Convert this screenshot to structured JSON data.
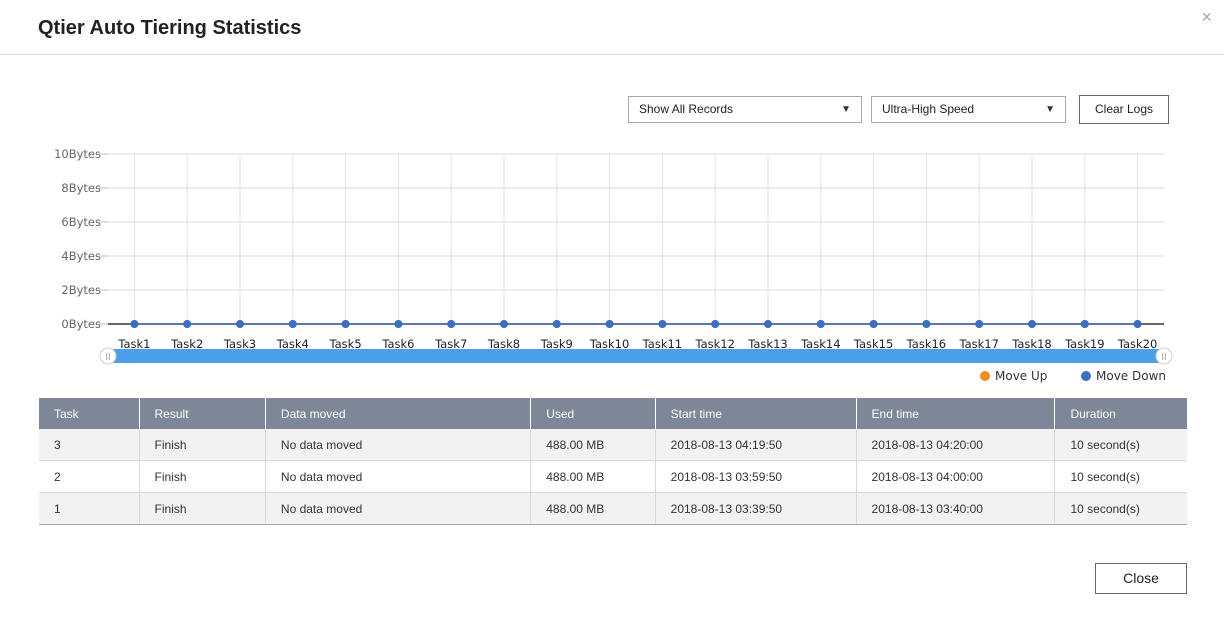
{
  "dialog": {
    "title": "Qtier Auto Tiering Statistics",
    "close_glyph": "×"
  },
  "filters": {
    "records_value": "Show All Records",
    "speed_value": "Ultra-High Speed",
    "caret": "▼",
    "clear_logs_label": "Clear Logs"
  },
  "chart_data": {
    "type": "line",
    "categories": [
      "Task1",
      "Task2",
      "Task3",
      "Task4",
      "Task5",
      "Task6",
      "Task7",
      "Task8",
      "Task9",
      "Task10",
      "Task11",
      "Task12",
      "Task13",
      "Task14",
      "Task15",
      "Task16",
      "Task17",
      "Task18",
      "Task19",
      "Task20"
    ],
    "yticks": [
      "0Bytes",
      "2Bytes",
      "4Bytes",
      "6Bytes",
      "8Bytes",
      "10Bytes"
    ],
    "ylim": [
      0,
      10
    ],
    "grid": true,
    "legend_position": "bottom-right",
    "series": [
      {
        "name": "Move Up",
        "color": "#f28d1f",
        "values": [
          0,
          0,
          0,
          0,
          0,
          0,
          0,
          0,
          0,
          0,
          0,
          0,
          0,
          0,
          0,
          0,
          0,
          0,
          0,
          0
        ]
      },
      {
        "name": "Move Down",
        "color": "#3a6fc4",
        "values": [
          0,
          0,
          0,
          0,
          0,
          0,
          0,
          0,
          0,
          0,
          0,
          0,
          0,
          0,
          0,
          0,
          0,
          0,
          0,
          0
        ]
      }
    ],
    "navigator": {
      "color": "#4a9eea",
      "handle_glyph": "ll"
    }
  },
  "table": {
    "columns": [
      "Task",
      "Result",
      "Data moved",
      "Used",
      "Start time",
      "End time",
      "Duration"
    ],
    "rows": [
      [
        "3",
        "Finish",
        "No data moved",
        "488.00 MB",
        "2018-08-13 04:19:50",
        "2018-08-13 04:20:00",
        "10 second(s)"
      ],
      [
        "2",
        "Finish",
        "No data moved",
        "488.00 MB",
        "2018-08-13 03:59:50",
        "2018-08-13 04:00:00",
        "10 second(s)"
      ],
      [
        "1",
        "Finish",
        "No data moved",
        "488.00 MB",
        "2018-08-13 03:39:50",
        "2018-08-13 03:40:00",
        "10 second(s)"
      ]
    ]
  },
  "footer": {
    "close_label": "Close"
  }
}
